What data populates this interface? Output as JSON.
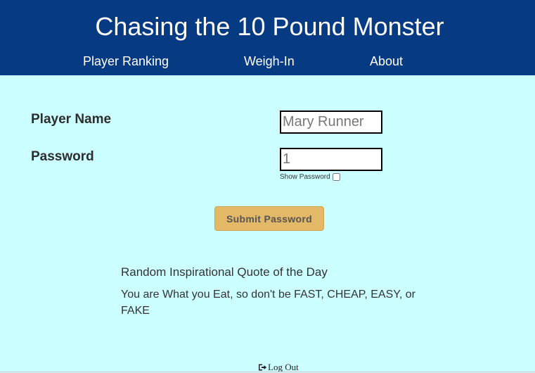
{
  "header": {
    "title": "Chasing the 10 Pound Monster",
    "nav": {
      "ranking": "Player Ranking",
      "weighin": "Weigh-In",
      "about": "About"
    }
  },
  "form": {
    "player_name_label": "Player Name",
    "player_name_value": "Mary Runner",
    "password_label": "Password",
    "password_value": "1",
    "show_password_label": "Show Password",
    "show_password_checked": false,
    "submit_label": "Submit Password"
  },
  "quote": {
    "heading": "Random Inspirational Quote of the Day",
    "text": "You are What you Eat, so don't be FAST, CHEAP, EASY, or FAKE"
  },
  "footer": {
    "logout_label": "Log Out",
    "logout_icon": "sign-out-icon"
  },
  "colors": {
    "header_bg": "#063a82",
    "page_bg": "#ccffff",
    "button_bg": "#e3b866"
  }
}
